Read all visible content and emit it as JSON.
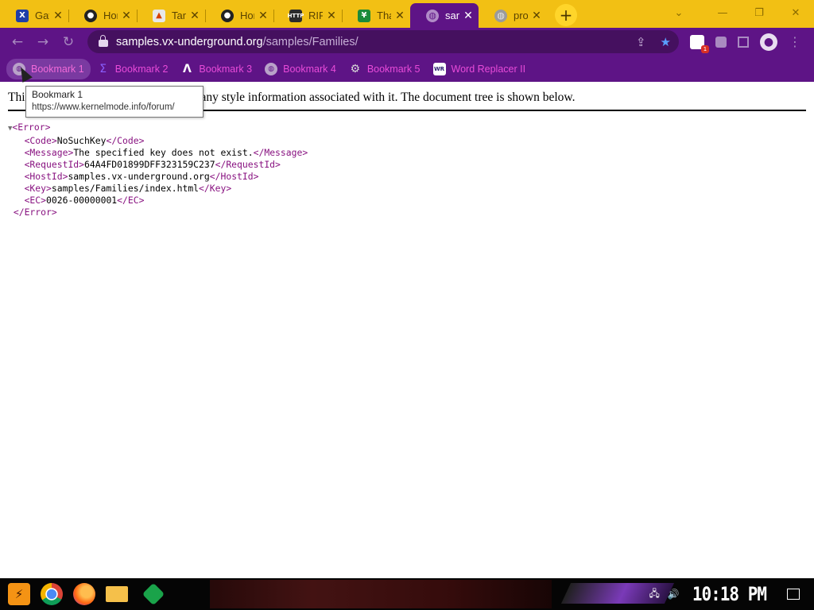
{
  "tabs": [
    {
      "title": "Gay F",
      "icon": "x-icon",
      "active": false
    },
    {
      "title": "Home",
      "icon": "mask-icon",
      "active": false
    },
    {
      "title": "Tamp",
      "icon": "chart-icon",
      "active": false
    },
    {
      "title": "Home",
      "icon": "mask-icon",
      "active": false
    },
    {
      "title": "RIP I",
      "icon": "http-icon",
      "active": false
    },
    {
      "title": "Than",
      "icon": "green-shield-icon",
      "active": false
    },
    {
      "title": "samp",
      "icon": "globe-icon",
      "active": true
    },
    {
      "title": "prox",
      "icon": "globe-icon",
      "active": false
    }
  ],
  "tab_close_glyph": "✕",
  "new_tab_glyph": "+",
  "window_controls": {
    "chevron": "⌄",
    "minimize": "—",
    "restore": "❐",
    "close": "✕"
  },
  "address_bar": {
    "host": "samples.vx-underground.org",
    "path": "/samples/Families/"
  },
  "toolbar_icons": {
    "back": "←",
    "forward": "→",
    "reload": "↻",
    "share": "⇪",
    "star": "★",
    "menu": "⋮"
  },
  "extension_badge": "1",
  "bookmarks": [
    {
      "label": "Bookmark 1",
      "icon": "globe-icon"
    },
    {
      "label": "Bookmark 2",
      "icon": "sigma-icon"
    },
    {
      "label": "Bookmark 3",
      "icon": "lambda-icon"
    },
    {
      "label": "Bookmark 4",
      "icon": "globe-icon"
    },
    {
      "label": "Bookmark 5",
      "icon": "gear-icon"
    },
    {
      "label": "Word Replacer II",
      "icon": "wr-icon"
    }
  ],
  "tooltip": {
    "title": "Bookmark 1",
    "url": "https://www.kernelmode.info/forum/"
  },
  "page": {
    "notice_start": "Thi",
    "notice_end": "any style information associated with it. The document tree is shown below.",
    "xml": {
      "open_root": "<Error>",
      "code_open": "<Code>",
      "code": "NoSuchKey",
      "code_close": "</Code>",
      "message_open": "<Message>",
      "message": "The specified key does not exist.",
      "message_close": "</Message>",
      "requestid_open": "<RequestId>",
      "requestid": "64A4FD01899DFF323159C237",
      "requestid_close": "</RequestId>",
      "hostid_open": "<HostId>",
      "hostid": "samples.vx-underground.org",
      "hostid_close": "</HostId>",
      "key_open": "<Key>",
      "key": "samples/Families/index.html",
      "key_close": "</Key>",
      "ec_open": "<EC>",
      "ec": "0026-00000001",
      "ec_close": "</EC>",
      "close_root": "</Error>",
      "collapse_glyph": "▼"
    }
  },
  "taskbar": {
    "clock": "10:18 PM",
    "apps": [
      "start-icon",
      "chrome-icon",
      "firefox-icon",
      "file-explorer-icon",
      "app-icon"
    ]
  },
  "colors": {
    "accent_tab": "#f2c014",
    "chrome_purple": "#5e1486",
    "bookmark_text": "#e84bd9"
  }
}
